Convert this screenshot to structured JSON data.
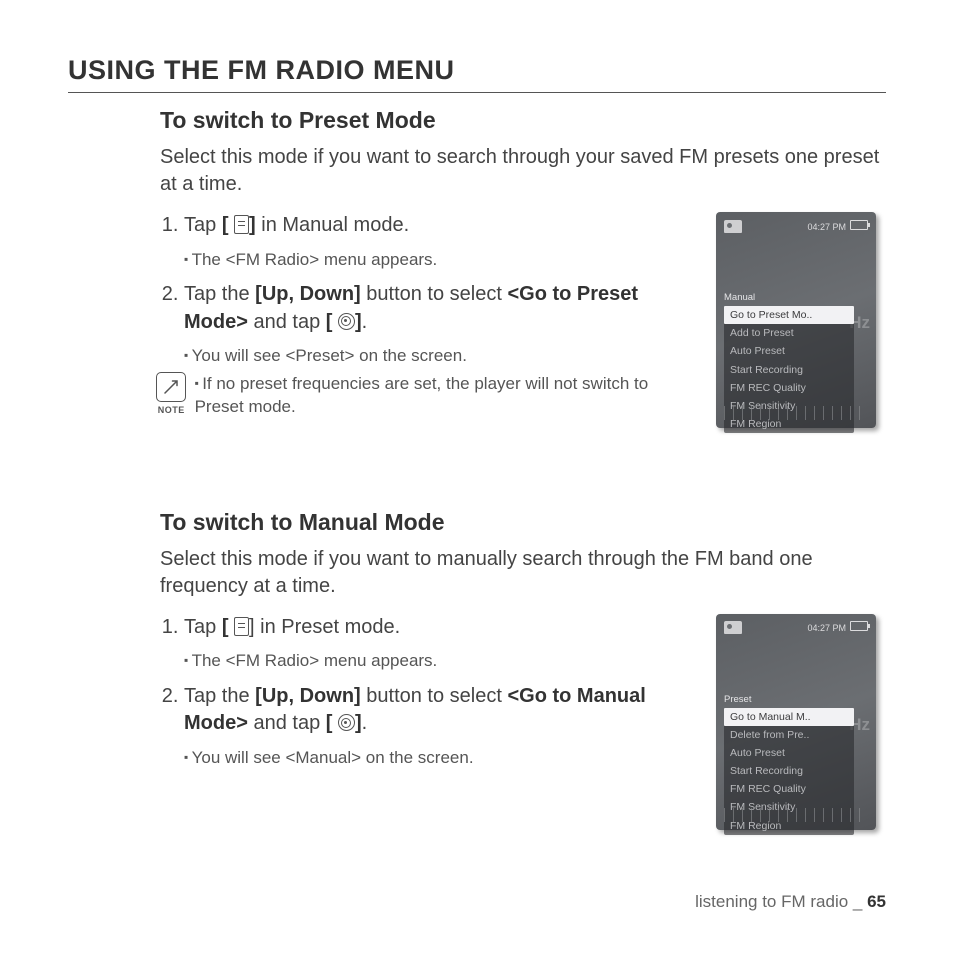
{
  "page_title": "USING THE FM RADIO MENU",
  "section1": {
    "heading": "To switch to Preset Mode",
    "intro": "Select this mode if you want to search through your saved FM presets one preset at a time.",
    "step1_pre": "Tap ",
    "step1_b1": "[",
    "step1_b2": "]",
    "step1_post": " in Manual mode.",
    "step1_sub": "The <FM Radio> menu appears.",
    "step2_pre": "Tap the ",
    "step2_b_updown": "[Up, Down]",
    "step2_mid": " button to select ",
    "step2_b_go": "<Go to Preset Mode>",
    "step2_and": " and tap ",
    "step2_b1": "[",
    "step2_b2": "]",
    "step2_end": ".",
    "step2_sub": "You will see <Preset> on the screen.",
    "note_label": "NOTE",
    "note_text": "If no preset frequencies are set, the player will not switch to Preset mode."
  },
  "screen1": {
    "time": "04:27 PM",
    "mode": "Manual",
    "hz": "Hz",
    "items": [
      "Go to Preset Mo..",
      "Add to Preset",
      "Auto Preset",
      "Start Recording",
      "FM REC Quality",
      "FM Sensitivity",
      "FM Region"
    ]
  },
  "section2": {
    "heading": "To switch to Manual Mode",
    "intro": "Select this mode if you want to manually search through the FM band one frequency at a time.",
    "step1_pre": "Tap ",
    "step1_b1": "[",
    "step1_post": "] in Preset mode.",
    "step1_sub": "The <FM Radio> menu appears.",
    "step2_pre": "Tap the ",
    "step2_b_updown": "[Up, Down]",
    "step2_mid": " button to select ",
    "step2_b_go": "<Go to Manual Mode>",
    "step2_and": " and tap ",
    "step2_b1": "[",
    "step2_b2": "]",
    "step2_end": ".",
    "step2_sub": "You will see <Manual> on the screen."
  },
  "screen2": {
    "time": "04:27 PM",
    "mode": "Preset",
    "hz": "Hz",
    "items": [
      "Go to Manual M..",
      "Delete from Pre..",
      "Auto Preset",
      "Start Recording",
      "FM REC Quality",
      "FM Sensitivity",
      "FM Region"
    ]
  },
  "footer": {
    "text": "listening to FM radio _ ",
    "page": "65"
  }
}
